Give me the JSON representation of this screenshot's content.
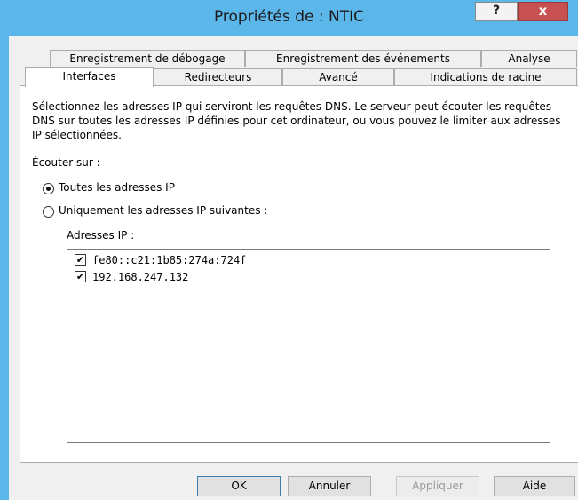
{
  "window": {
    "title": "Propriétés de : NTIC",
    "help_label": "?",
    "close_label": "x"
  },
  "tabs_row1": [
    {
      "label": "Enregistrement de débogage"
    },
    {
      "label": "Enregistrement des événements"
    },
    {
      "label": "Analyse"
    }
  ],
  "tabs_row2": [
    {
      "label": "Interfaces",
      "active": true
    },
    {
      "label": "Redirecteurs"
    },
    {
      "label": "Avancé"
    },
    {
      "label": "Indications de racine"
    }
  ],
  "panel": {
    "description": "Sélectionnez les adresses IP qui serviront les requêtes DNS. Le serveur peut écouter les requêtes DNS sur toutes les adresses IP définies pour cet ordinateur, ou vous pouvez le limiter aux adresses IP sélectionnées.",
    "listen_label": "Écouter sur :",
    "radio_all": {
      "label": "Toutes les adresses IP",
      "checked": true
    },
    "radio_specific": {
      "label": "Uniquement les adresses IP suivantes :",
      "checked": false
    },
    "ip_list_label": "Adresses IP :",
    "ip_addresses": [
      {
        "address": "fe80::c21:1b85:274a:724f",
        "checked": true
      },
      {
        "address": "192.168.247.132",
        "checked": true
      }
    ]
  },
  "buttons": {
    "ok": "OK",
    "cancel": "Annuler",
    "apply": "Appliquer",
    "help": "Aide"
  }
}
